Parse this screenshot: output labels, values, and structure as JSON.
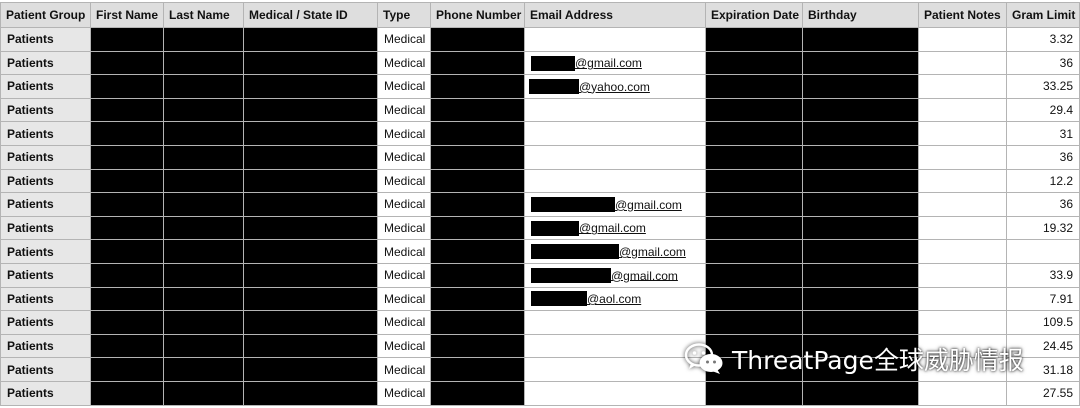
{
  "columns": [
    "Patient Group",
    "First Name",
    "Last Name",
    "Medical / State ID",
    "Type",
    "Phone Number",
    "Email Address",
    "Expiration Date",
    "Birthday",
    "Patient Notes",
    "Gram Limit"
  ],
  "rows": [
    {
      "group": "Patients",
      "type": "Medical",
      "email": "",
      "gram": "3.32"
    },
    {
      "group": "Patients",
      "type": "Medical",
      "email": "@gmail.com",
      "gram": "36"
    },
    {
      "group": "Patients",
      "type": "Medical",
      "email": "@yahoo.com",
      "gram": "33.25"
    },
    {
      "group": "Patients",
      "type": "Medical",
      "email": "",
      "gram": "29.4"
    },
    {
      "group": "Patients",
      "type": "Medical",
      "email": "",
      "gram": "31"
    },
    {
      "group": "Patients",
      "type": "Medical",
      "email": "",
      "gram": "36"
    },
    {
      "group": "Patients",
      "type": "Medical",
      "email": "",
      "gram": "12.2"
    },
    {
      "group": "Patients",
      "type": "Medical",
      "email": "@gmail.com",
      "gram": "36"
    },
    {
      "group": "Patients",
      "type": "Medical",
      "email": "@gmail.com",
      "gram": "19.32"
    },
    {
      "group": "Patients",
      "type": "Medical",
      "email": "@gmail.com",
      "gram": ""
    },
    {
      "group": "Patients",
      "type": "Medical",
      "email": "@gmail.com",
      "gram": "33.9"
    },
    {
      "group": "Patients",
      "type": "Medical",
      "email": "@aol.com",
      "gram": "7.91"
    },
    {
      "group": "Patients",
      "type": "Medical",
      "email": "",
      "gram": "109.5"
    },
    {
      "group": "Patients",
      "type": "Medical",
      "email": "",
      "gram": "24.45"
    },
    {
      "group": "Patients",
      "type": "Medical",
      "email": "",
      "gram": "31.18"
    },
    {
      "group": "Patients",
      "type": "Medical",
      "email": "",
      "gram": "27.55"
    }
  ],
  "watermark": {
    "text": "ThreatPage全球威胁情报",
    "icon": "wechat-icon"
  }
}
